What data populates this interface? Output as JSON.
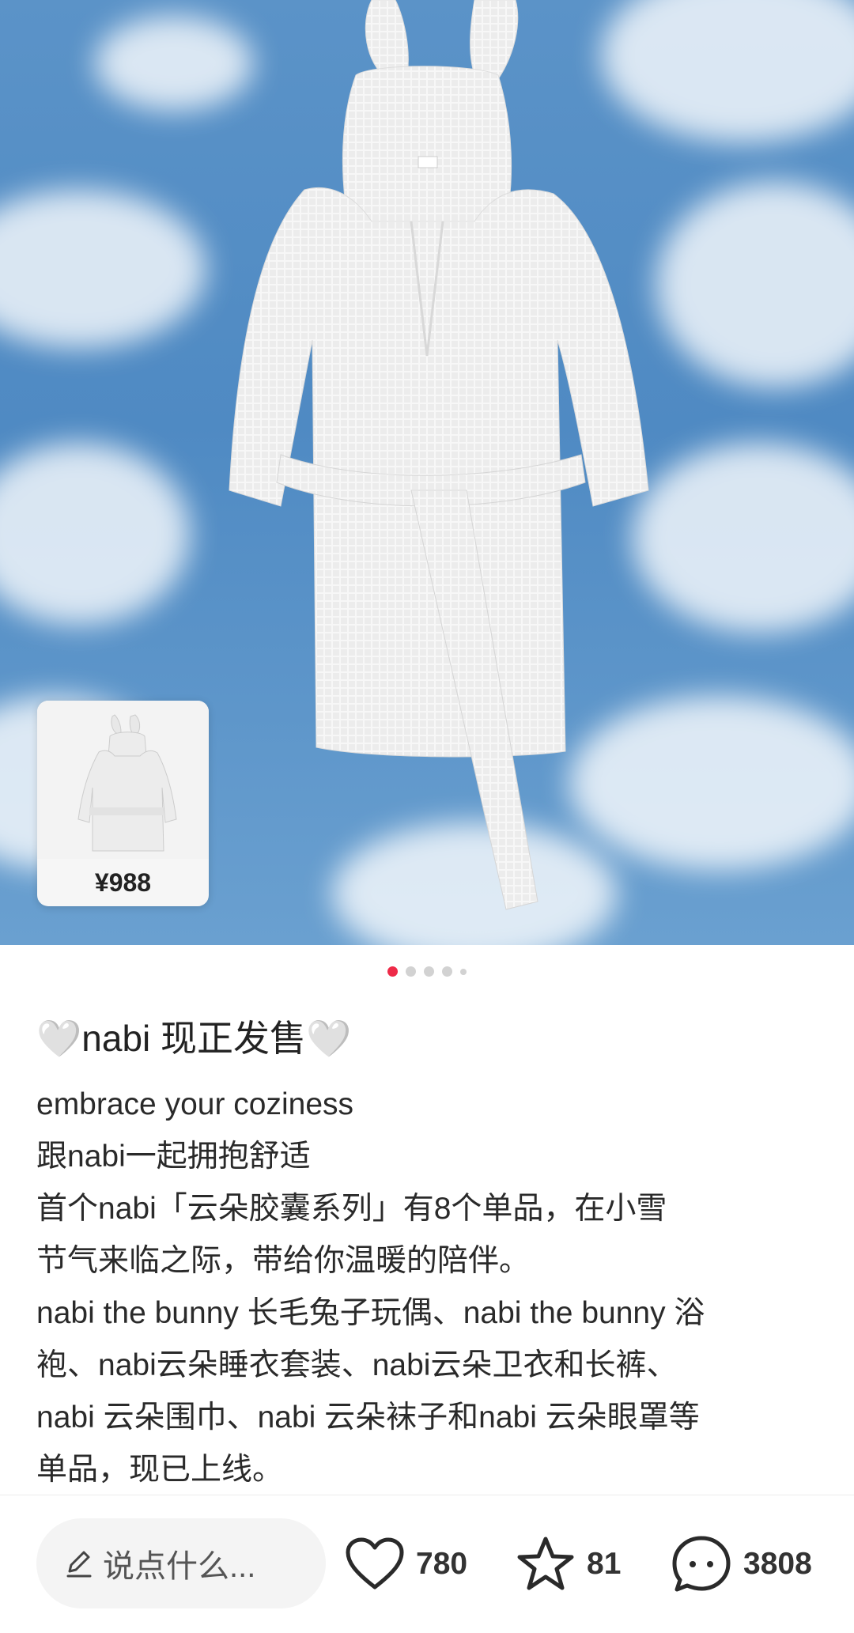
{
  "product_card": {
    "price": "¥988",
    "thumbnail_icon": "bathrobe-thumbnail"
  },
  "carousel": {
    "total": 5,
    "active_index": 0
  },
  "post": {
    "title": "🤍nabi 现正发售🤍",
    "lines": [
      "embrace your coziness",
      "跟nabi一起拥抱舒适",
      "首个nabi「云朵胶囊系列」有8个单品，在小雪",
      "节气来临之际，带给你温暖的陪伴。",
      "nabi the bunny 长毛兔子玩偶、nabi the bunny 浴",
      "袍、nabi云朵睡衣套装、nabi云朵卫衣和长裤、",
      "nabi 云朵围巾、nabi 云朵袜子和nabi 云朵眼罩等",
      "单品，现已上线。"
    ]
  },
  "bottom_bar": {
    "comment_placeholder": "说点什么...",
    "likes": "780",
    "favorites": "81",
    "comments": "3808"
  },
  "colors": {
    "accent": "#ee2a48",
    "sky": "#5b93c8"
  }
}
